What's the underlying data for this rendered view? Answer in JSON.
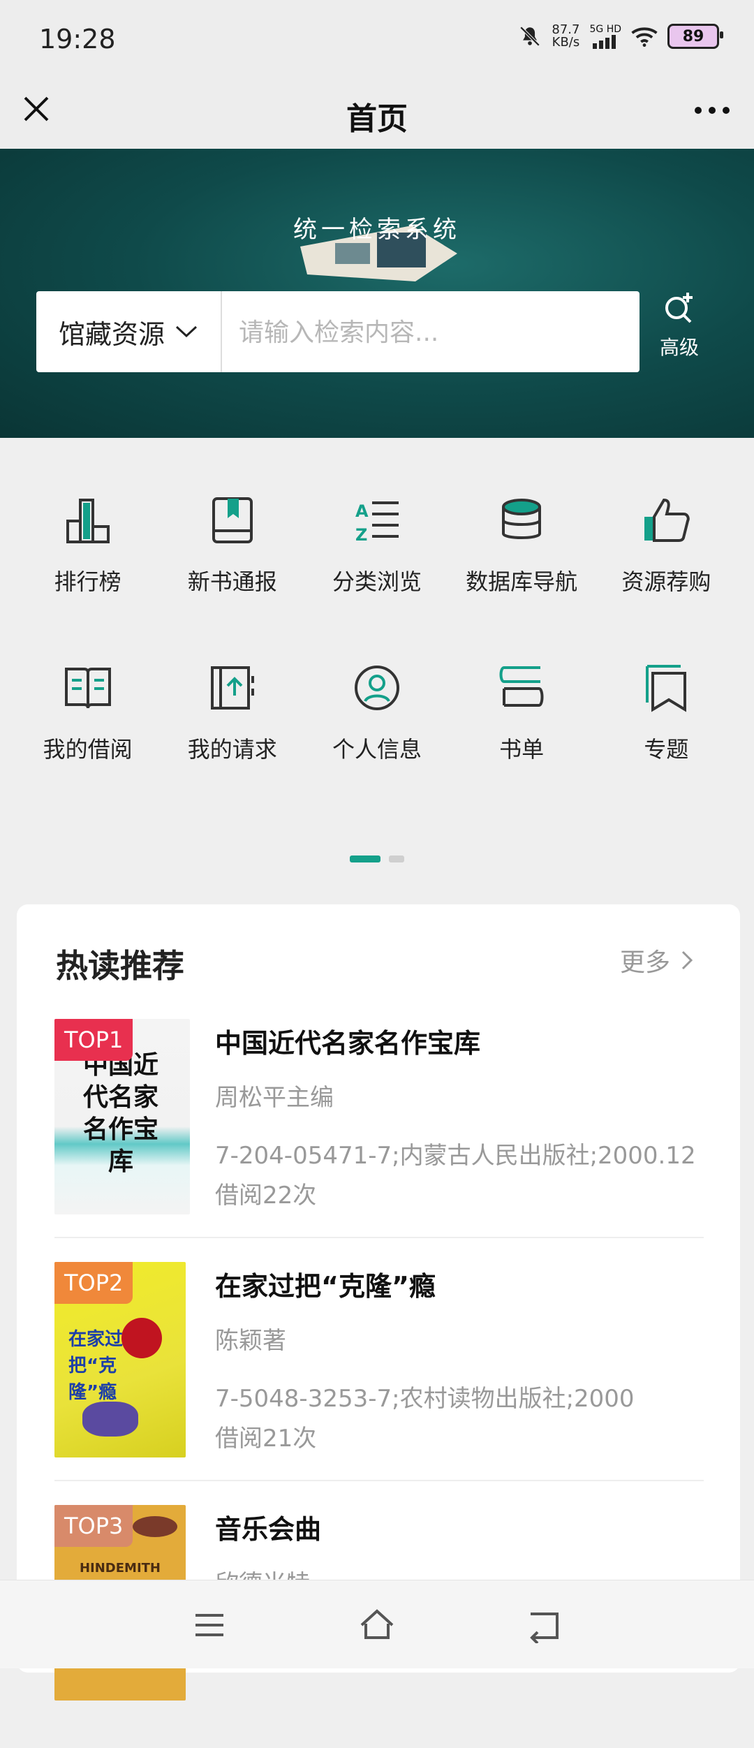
{
  "status": {
    "time": "19:28",
    "net_speed": "87.7",
    "net_unit": "KB/s",
    "signal_label": "5G HD",
    "battery": "89"
  },
  "header": {
    "title": "首页"
  },
  "banner": {
    "title": "统一检索系统",
    "scope_label": "馆藏资源",
    "search_placeholder": "请输入检索内容...",
    "advanced_label": "高级"
  },
  "grid": {
    "row1": [
      {
        "label": "排行榜",
        "icon": "ranking-icon"
      },
      {
        "label": "新书通报",
        "icon": "book-icon"
      },
      {
        "label": "分类浏览",
        "icon": "az-list-icon"
      },
      {
        "label": "数据库导航",
        "icon": "database-icon"
      },
      {
        "label": "资源荐购",
        "icon": "thumb-up-icon"
      }
    ],
    "row2": [
      {
        "label": "我的借阅",
        "icon": "open-book-icon"
      },
      {
        "label": "我的请求",
        "icon": "request-icon"
      },
      {
        "label": "个人信息",
        "icon": "user-icon"
      },
      {
        "label": "书单",
        "icon": "booklist-icon"
      },
      {
        "label": "专题",
        "icon": "bookmark-icon"
      }
    ]
  },
  "pager": {
    "pages": 2,
    "active": 1
  },
  "hot": {
    "title": "热读推荐",
    "more_label": "更多",
    "books": [
      {
        "rank": "TOP1",
        "title": "中国近代名家名作宝库",
        "author": "周松平主编",
        "meta": "7-204-05471-7;内蒙古人民出版社;2000.12",
        "borrow": "借阅22次",
        "cover_text": "中国近代名家名作宝库"
      },
      {
        "rank": "TOP2",
        "title": "在家过把“克隆”瘾",
        "author": "陈颖著",
        "meta": "7-5048-3253-7;农村读物出版社;2000",
        "borrow": "借阅21次",
        "cover_text": "在家过把“克隆”瘾"
      },
      {
        "rank": "TOP3",
        "title": "音乐会曲",
        "author": "欣德米特",
        "meta": "",
        "borrow": "",
        "cover_text": "HINDEMITH"
      }
    ]
  },
  "colors": {
    "accent": "#14a08a",
    "top1": "#e8304f",
    "top2": "#f0883a",
    "top3": "#d88a6a"
  }
}
